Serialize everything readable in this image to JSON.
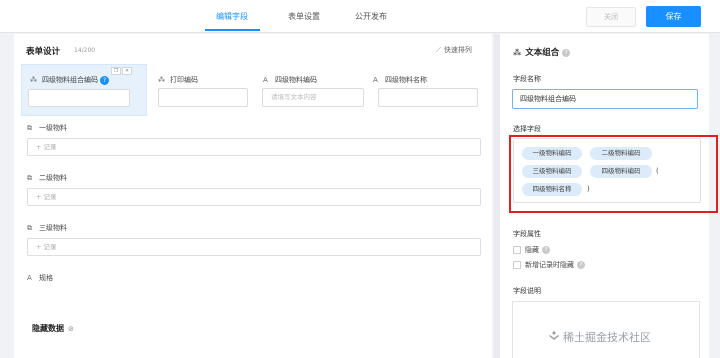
{
  "topbar": {
    "tabs": [
      {
        "label": "编辑字段",
        "active": true
      },
      {
        "label": "表单设置",
        "active": false
      },
      {
        "label": "公开发布",
        "active": false
      }
    ],
    "close_label": "关闭",
    "save_label": "保存"
  },
  "canvas": {
    "title": "表单设计",
    "count": "14/200",
    "sort_label": "快速排列",
    "row1": [
      {
        "label": "四级物料组合编码",
        "icon": "tree-icon"
      },
      {
        "label": "打印编码",
        "icon": "tree-icon"
      },
      {
        "label": "四级物料编码",
        "icon": "text-a-icon",
        "placeholder": "请填写文本内容"
      },
      {
        "label": "四级物料名称",
        "icon": "text-a-icon"
      }
    ],
    "sections": [
      {
        "label": "一级物料",
        "add_label": "+ 记录"
      },
      {
        "label": "二级物料",
        "add_label": "+ 记录"
      },
      {
        "label": "三级物料",
        "add_label": "+ 记录"
      }
    ],
    "spec_label": "规格",
    "hidden_title": "隐藏数据"
  },
  "panel": {
    "title": "文本组合",
    "name_label": "字段名称",
    "name_value": "四级物料组合编码",
    "select_label": "选择字段",
    "tags": [
      "一级物料编码",
      "二级物料编码",
      "三级物料编码",
      "四级物料编码",
      "四级物料名称"
    ],
    "paren_open": "(",
    "paren_close": ")",
    "props_label": "字段属性",
    "hide_label": "隐藏",
    "new_hide_label": "新增记录时隐藏",
    "desc_label": "字段说明"
  },
  "watermark": "稀土掘金技术社区",
  "colors": {
    "accent": "#1890ff",
    "highlight": "#e21e1e",
    "tag_bg": "#dcebfa"
  }
}
